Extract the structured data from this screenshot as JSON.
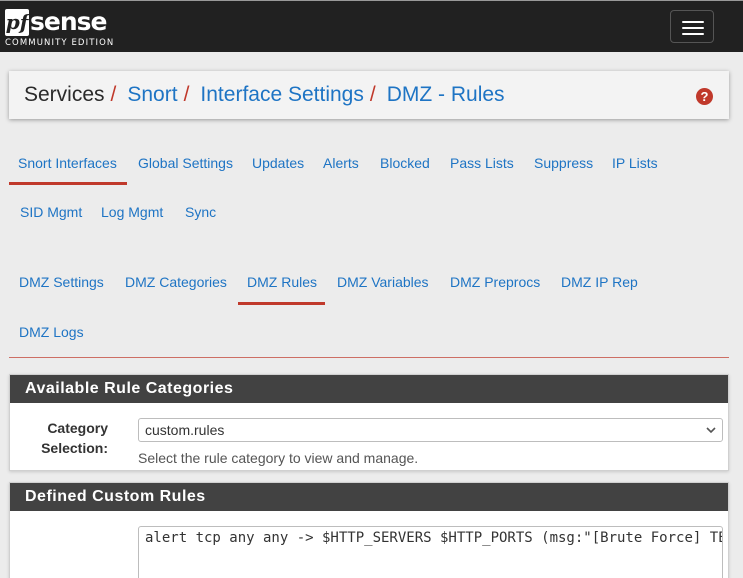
{
  "brand": {
    "name_box": "pf",
    "name_rest": "sense",
    "subtitle": "COMMUNITY EDITION"
  },
  "breadcrumb": {
    "items": [
      "Services",
      "Snort",
      "Interface Settings",
      "DMZ - Rules"
    ],
    "separator": "/"
  },
  "help_icon": "question-circle-icon",
  "tabs_main": [
    "Snort Interfaces",
    "Global Settings",
    "Updates",
    "Alerts",
    "Blocked",
    "Pass Lists",
    "Suppress",
    "IP Lists",
    "SID Mgmt",
    "Log Mgmt",
    "Sync"
  ],
  "tabs_interface": [
    "DMZ Settings",
    "DMZ Categories",
    "DMZ Rules",
    "DMZ Variables",
    "DMZ Preprocs",
    "DMZ IP Rep",
    "DMZ Logs"
  ],
  "panel_categories": {
    "title": "Available Rule Categories",
    "label_line1": "Category",
    "label_line2": "Selection:",
    "selected": "custom.rules",
    "help": "Select the rule category to view and manage."
  },
  "panel_custom": {
    "title": "Defined Custom Rules",
    "rule_text": "alert tcp any any -> $HTTP_SERVERS $HTTP_PORTS (msg:\"[Brute Force] TE"
  },
  "colors": {
    "navbar": "#212121",
    "link": "#1e74c4",
    "accent": "#c0392b",
    "panel_head": "#424242"
  }
}
